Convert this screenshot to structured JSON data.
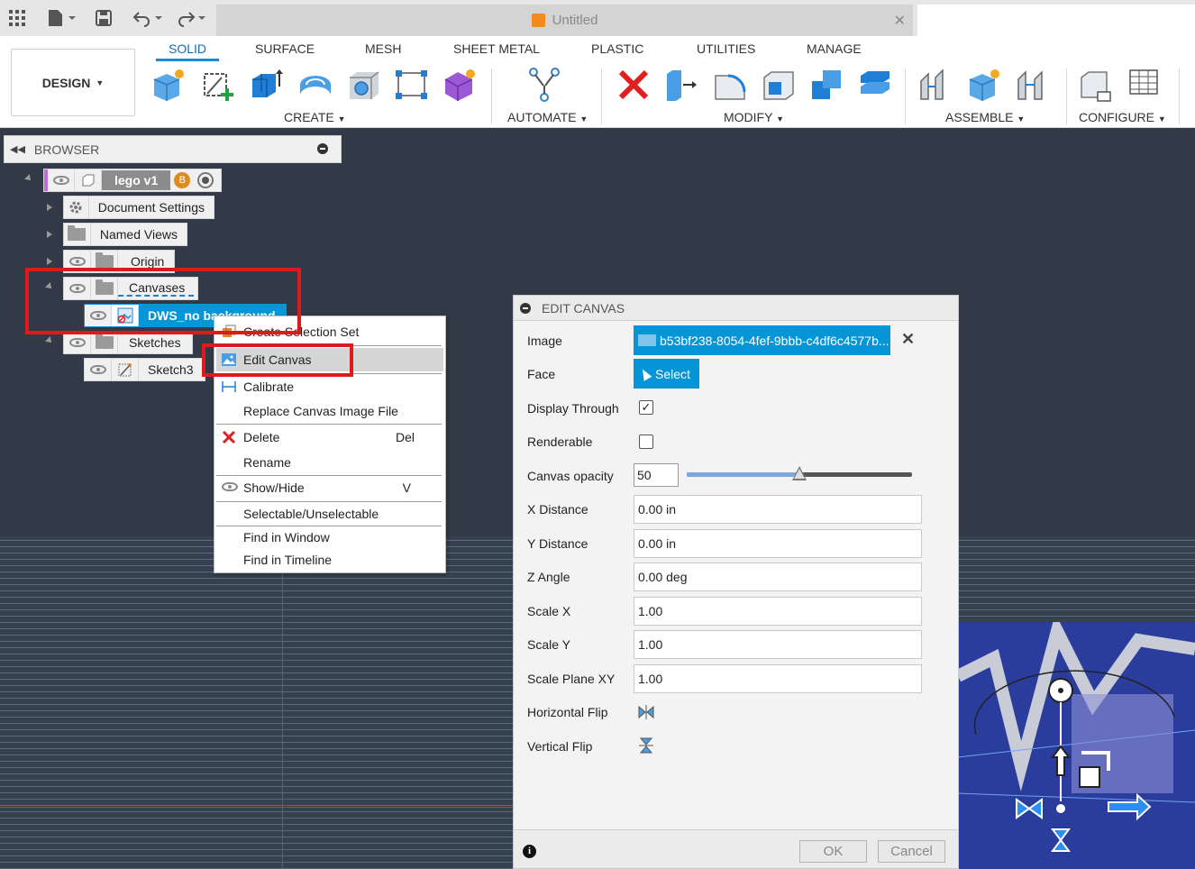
{
  "titlebar": {
    "doc_title": "Untitled",
    "icons": [
      "grid-icon",
      "file-icon",
      "save-icon",
      "undo-icon",
      "redo-icon"
    ]
  },
  "ribbon": {
    "workspace": "DESIGN",
    "tabs": [
      "SOLID",
      "SURFACE",
      "MESH",
      "SHEET METAL",
      "PLASTIC",
      "UTILITIES",
      "MANAGE"
    ],
    "active_tab": "SOLID",
    "groups": {
      "create": "CREATE",
      "automate": "AUTOMATE",
      "modify": "MODIFY",
      "assemble": "ASSEMBLE",
      "configure": "CONFIGURE"
    },
    "accent": "#1e8ad6"
  },
  "browser": {
    "title": "BROWSER",
    "root": "lego v1",
    "root_badge": "B",
    "items": {
      "document_settings": "Document Settings",
      "named_views": "Named Views",
      "origin": "Origin",
      "canvases": "Canvases",
      "canvas_item": "DWS_no background",
      "sketches": "Sketches",
      "sketch3": "Sketch3"
    }
  },
  "context_menu": {
    "items": [
      {
        "label": "Create Selection Set",
        "shortcut": ""
      },
      {
        "label": "Edit Canvas",
        "shortcut": ""
      },
      {
        "label": "Calibrate",
        "shortcut": ""
      },
      {
        "label": "Replace Canvas Image File",
        "shortcut": ""
      },
      {
        "label": "Delete",
        "shortcut": "Del"
      },
      {
        "label": "Rename",
        "shortcut": ""
      },
      {
        "label": "Show/Hide",
        "shortcut": "V"
      },
      {
        "label": "Selectable/Unselectable",
        "shortcut": ""
      },
      {
        "label": "Find in Window",
        "shortcut": ""
      },
      {
        "label": "Find in Timeline",
        "shortcut": ""
      }
    ],
    "highlighted": "Edit Canvas"
  },
  "edit_canvas": {
    "title": "EDIT CANVAS",
    "image_label": "Image",
    "image_value": "b53bf238-8054-4fef-9bbb-c4df6c4577b...",
    "face_label": "Face",
    "face_button": "Select",
    "display_through_label": "Display Through",
    "display_through": true,
    "renderable_label": "Renderable",
    "renderable": false,
    "opacity_label": "Canvas opacity",
    "opacity_value": "50",
    "opacity_fraction": 0.5,
    "x_distance_label": "X Distance",
    "x_distance": "0.00 in",
    "y_distance_label": "Y Distance",
    "y_distance": "0.00 in",
    "z_angle_label": "Z Angle",
    "z_angle": "0.00 deg",
    "scale_x_label": "Scale X",
    "scale_x": "1.00",
    "scale_y_label": "Scale Y",
    "scale_y": "1.00",
    "scale_plane_label": "Scale Plane XY",
    "scale_plane": "1.00",
    "hflip_label": "Horizontal Flip",
    "vflip_label": "Vertical Flip",
    "ok": "OK",
    "cancel": "Cancel",
    "button_color": "#0696d7"
  },
  "annotation_color": "#e01a1a"
}
